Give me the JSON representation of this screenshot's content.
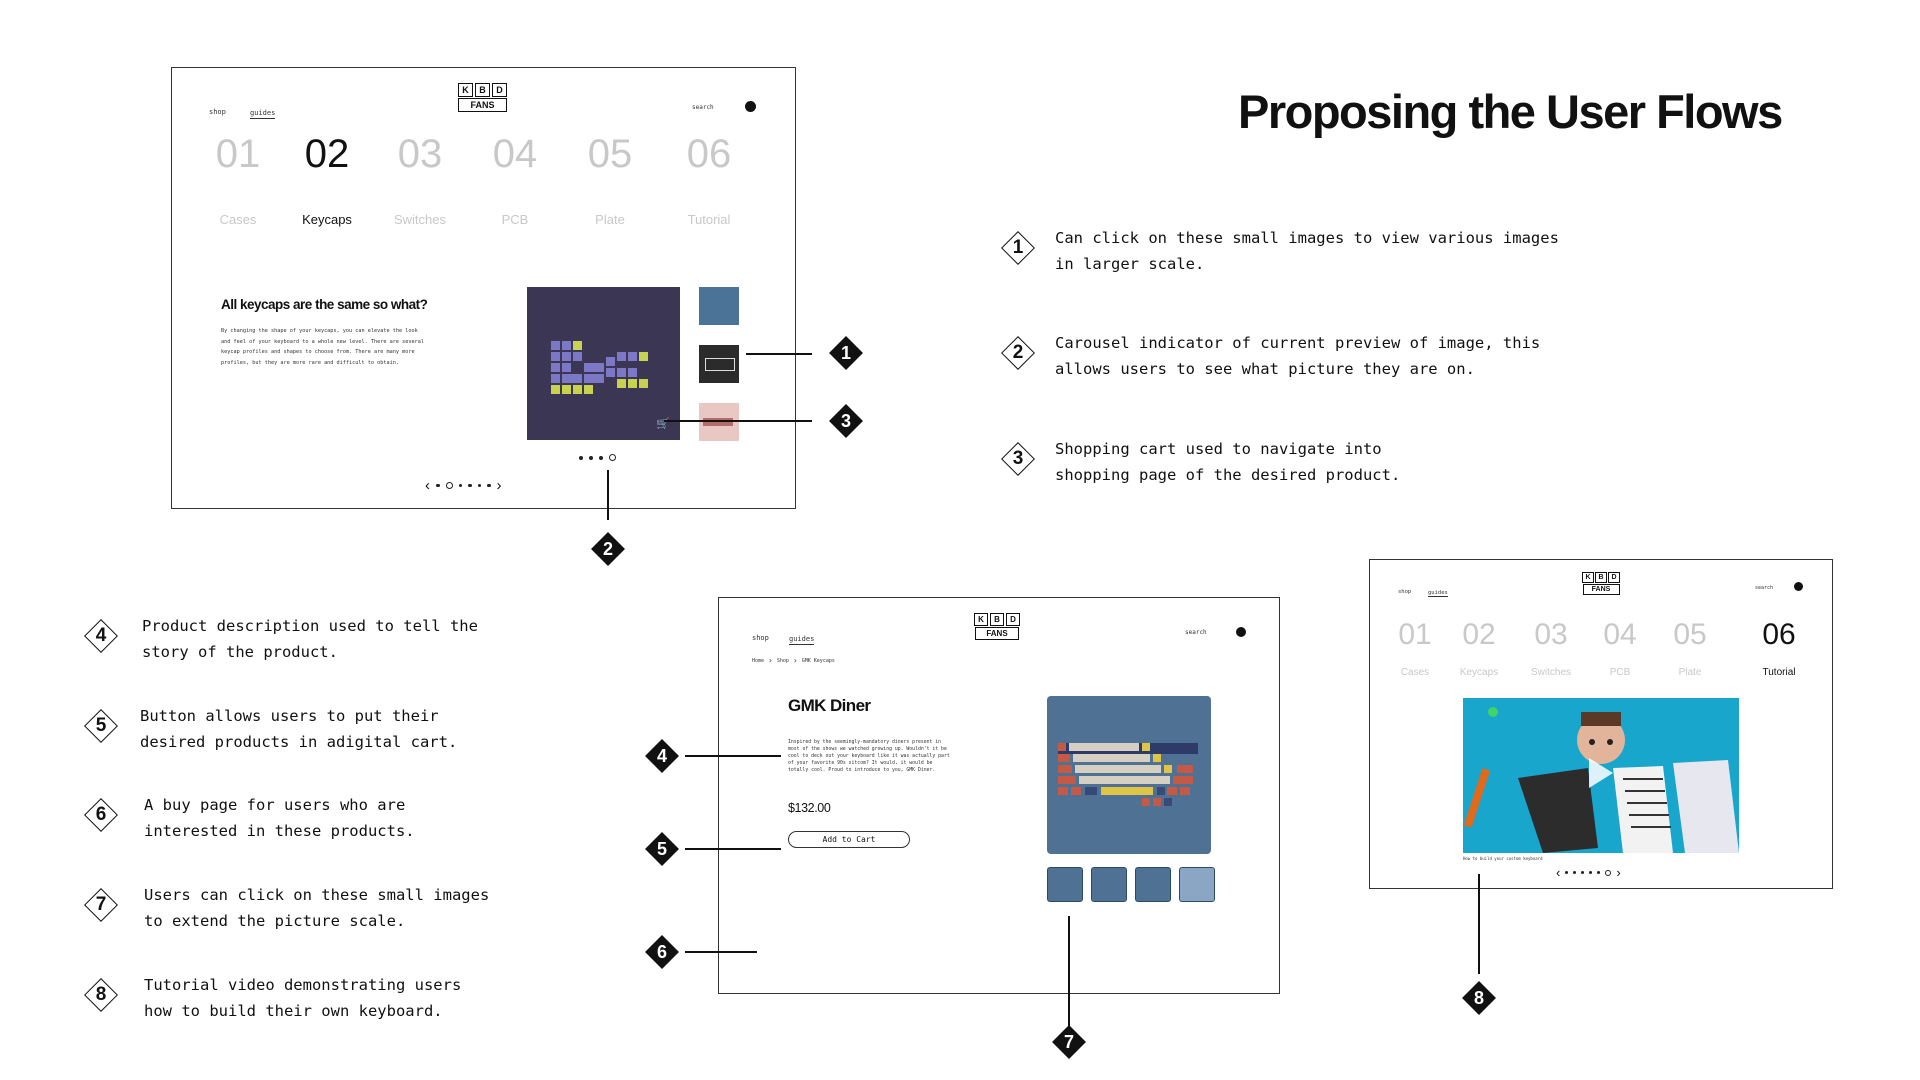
{
  "slide": {
    "title": "Proposing the User Flows"
  },
  "brand": {
    "logo_top": [
      "K",
      "B",
      "D"
    ],
    "logo_bottom": "FANS"
  },
  "nav": {
    "shop": "shop",
    "guides": "guides",
    "search": "search"
  },
  "steps": [
    {
      "num": "01",
      "label": "Cases"
    },
    {
      "num": "02",
      "label": "Keycaps"
    },
    {
      "num": "03",
      "label": "Switches"
    },
    {
      "num": "04",
      "label": "PCB"
    },
    {
      "num": "05",
      "label": "Plate"
    },
    {
      "num": "06",
      "label": "Tutorial"
    }
  ],
  "screen1": {
    "active_step": "02",
    "heading": "All keycaps are the same so what?",
    "body": "By changing the shape of your keycaps, you can elevate the look and feel of your keyboard to a whole new level. There are several keycap profiles and shapes to choose from. There are many more profiles, but they are more rare and difficult to obtain.",
    "image_bg": "#3b3653"
  },
  "screen2": {
    "breadcrumb": [
      "Home",
      "Shop",
      "GMK Keycaps"
    ],
    "product_name": "GMK Diner",
    "description": "Inspired by the seemingly-mandatory diners present in most of the shows we watched growing up. Wouldn't it be cool to deck out your keyboard like it was actually part of your favorite 90s sitcom? It would, it would be totally cool. Proud to introduce to you, GMK Diner.",
    "price": "$132.00",
    "add_to_cart": "Add to Cart",
    "image_bg": "#4f7194"
  },
  "screen3": {
    "active_step": "06",
    "video_caption": "How to build your custom keyboard",
    "video_bg": "#19a6cc"
  },
  "markers": [
    "1",
    "2",
    "3",
    "4",
    "5",
    "6",
    "7",
    "8"
  ],
  "notes": [
    {
      "num": "1",
      "text": "Can click on these small images to view various images\nin larger scale."
    },
    {
      "num": "2",
      "text": "Carousel indicator of current preview of image, this\nallows users to see what picture they are on."
    },
    {
      "num": "3",
      "text": "Shopping cart used to navigate into\nshopping page of the desired product."
    },
    {
      "num": "4",
      "text": "Product description used to tell the\nstory of the product."
    },
    {
      "num": "5",
      "text": "Button allows users to put their\ndesired products in adigital cart."
    },
    {
      "num": "6",
      "text": "A buy page for users who are\ninterested in these products."
    },
    {
      "num": "7",
      "text": "Users can click on these small images\nto extend the picture scale."
    },
    {
      "num": "8",
      "text": "Tutorial video demonstrating users\nhow to build their own keyboard."
    }
  ]
}
